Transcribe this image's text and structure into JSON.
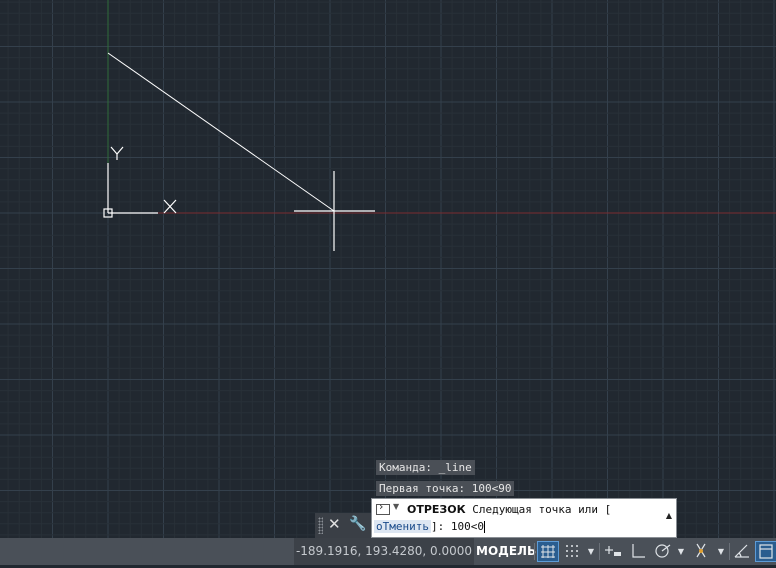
{
  "history": [
    "Команда:  _line",
    "Первая точка: 100<90"
  ],
  "command": {
    "name": "ОТРЕЗОК",
    "prompt": " Следующая точка или [",
    "option": "оТменить",
    "suffix": "]:  100<0",
    "icon": "command-prompt-icon"
  },
  "toolbar": {
    "close_icon": "close-icon",
    "customize_icon": "wrench-icon"
  },
  "statusbar": {
    "coords": "-189.1916, 193.4280, 0.0000",
    "model_label": "МОДЕЛЬ",
    "icons": [
      "grid-icon",
      "snap-icon",
      "dynamic-input-icon",
      "ortho-icon",
      "polar-icon",
      "isodraft-icon",
      "object-snap-track-icon",
      "annotation-icon"
    ]
  },
  "ucs": {
    "x_label": "X",
    "y_label": "Y"
  },
  "colors": {
    "background": "#212830",
    "grid_minor": "#283038",
    "grid_major": "#34404c",
    "x_axis": "#7a2b2f",
    "y_axis": "#2f6b3a",
    "line": "#ffffff"
  }
}
